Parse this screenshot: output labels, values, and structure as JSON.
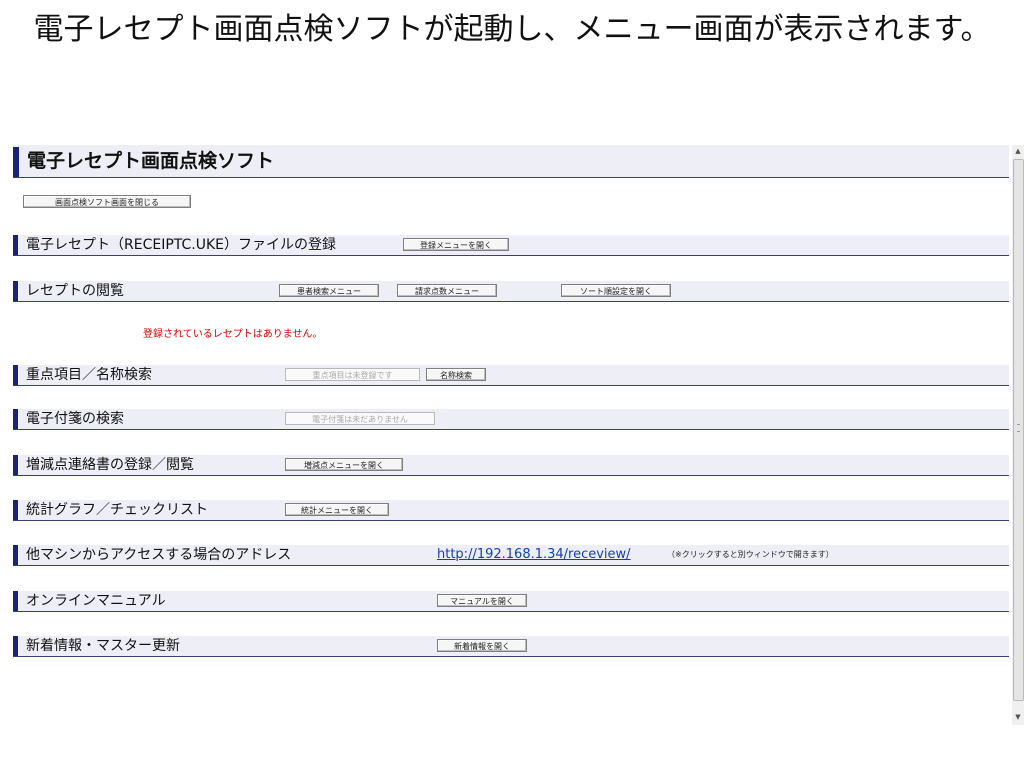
{
  "slide": {
    "caption": "電子レセプト画面点検ソフトが起動し、メニュー画面が表示されます。"
  },
  "app": {
    "title": "電子レセプト画面点検ソフト",
    "close_button": "画面点検ソフト画面を閉じる"
  },
  "sections": {
    "register": {
      "label": "電子レセプト（RECEIPTC.UKE）ファイルの登録",
      "open_menu_button": "登録メニューを開く"
    },
    "browse": {
      "label": "レセプトの閲覧",
      "patient_search_button": "患者検索メニュー",
      "claim_points_button": "請求点数メニュー",
      "sort_settings_button": "ソート順設定を開く",
      "empty_notice": "登録されているレセプトはありません。"
    },
    "priority": {
      "label": "重点項目／名称検索",
      "priority_button": "重点項目は未登録です",
      "name_search_button": "名称検索"
    },
    "sticky": {
      "label": "電子付箋の検索",
      "sticky_button": "電子付箋は未だありません"
    },
    "adjustment": {
      "label": "増減点連絡書の登録／閲覧",
      "open_menu_button": "増減点メニューを開く"
    },
    "stats": {
      "label": "統計グラフ／チェックリスト",
      "open_menu_button": "統計メニューを開く"
    },
    "address": {
      "label": "他マシンからアクセスする場合のアドレス",
      "url": "http://192.168.1.34/receview/",
      "note": "（※クリックすると別ウィンドウで開きます）"
    },
    "manual": {
      "label": "オンラインマニュアル",
      "open_button": "マニュアルを開く"
    },
    "news": {
      "label": "新着情報・マスター更新",
      "open_button": "新着情報を開く"
    }
  },
  "colors": {
    "accent_bar": "#1b2377",
    "section_bg": "#eeeef7",
    "link": "#1a3ea8",
    "notice": "#d00000"
  }
}
